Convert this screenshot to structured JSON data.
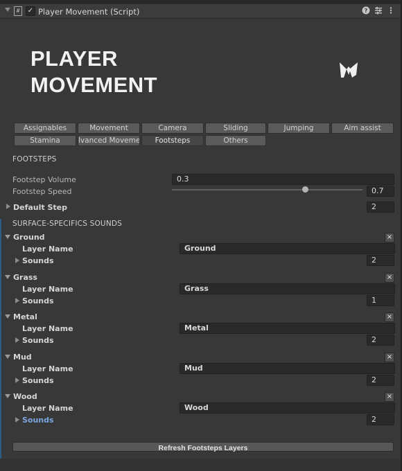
{
  "header": {
    "title": "Player Movement (Script)",
    "enabled_check": "✓",
    "script_icon": "#",
    "icons": [
      "help-icon",
      "presets-icon",
      "more-icon"
    ]
  },
  "logo": {
    "line1": "PLAYER",
    "line2": "MOVEMENT"
  },
  "tabs": {
    "row1": [
      "Assignables",
      "Movement",
      "Camera",
      "Sliding",
      "Jumping",
      "Aim assist"
    ],
    "row2": [
      "Stamina",
      "lvanced Moveme",
      "Footsteps",
      "Others"
    ],
    "active": "Footsteps"
  },
  "footsteps": {
    "section_title": "FOOTSTEPS",
    "volume_label": "Footstep Volume",
    "volume_value": "0.3",
    "speed_label": "Footstep Speed",
    "speed_value": "0.7",
    "speed_fraction": 0.7,
    "default_step_label": "Default Step",
    "default_step_value": "2"
  },
  "surface": {
    "section_title": "SURFACE-SPECIFICS SOUNDS",
    "layer_name_label": "Layer Name",
    "sounds_label": "Sounds",
    "remove_glyph": "×",
    "items": [
      {
        "name": "Ground",
        "layer": "Ground",
        "sounds": "2"
      },
      {
        "name": "Grass",
        "layer": "Grass",
        "sounds": "1"
      },
      {
        "name": "Metal",
        "layer": "Metal",
        "sounds": "2"
      },
      {
        "name": "Mud",
        "layer": "Mud",
        "sounds": "2"
      },
      {
        "name": "Wood",
        "layer": "Wood",
        "sounds": "2"
      }
    ]
  },
  "refresh_label": "Refresh Footsteps Layers",
  "colors": {
    "accent_blue": "#7aa6e0",
    "panel": "#383838",
    "field": "#2a2a2a"
  }
}
